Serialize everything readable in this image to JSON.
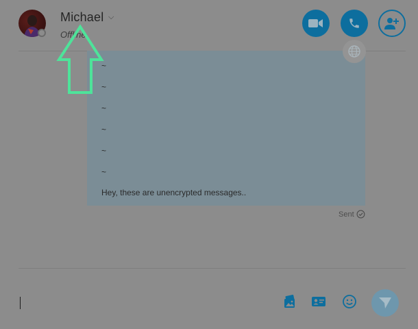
{
  "contact": {
    "name": "Michael",
    "status": "Offline",
    "avatar_icon": "avatar-photo"
  },
  "header_actions": {
    "video_icon": "video-camera-icon",
    "call_icon": "phone-icon",
    "add_people_icon": "add-person-icon"
  },
  "message": {
    "lines": [
      "~",
      "~",
      "~",
      "~",
      "~",
      "~",
      "Hey, these are unencrypted messages.."
    ],
    "status": "Sent",
    "status_icon": "check-circle-icon"
  },
  "composer": {
    "value": "",
    "tools": [
      "image-icon",
      "contact-card-icon",
      "emoji-icon"
    ],
    "send_icon": "send-icon"
  },
  "colors": {
    "accent": "#0d6e9e",
    "annotation": "#4ee39a",
    "bubble": "#7b8d96"
  }
}
